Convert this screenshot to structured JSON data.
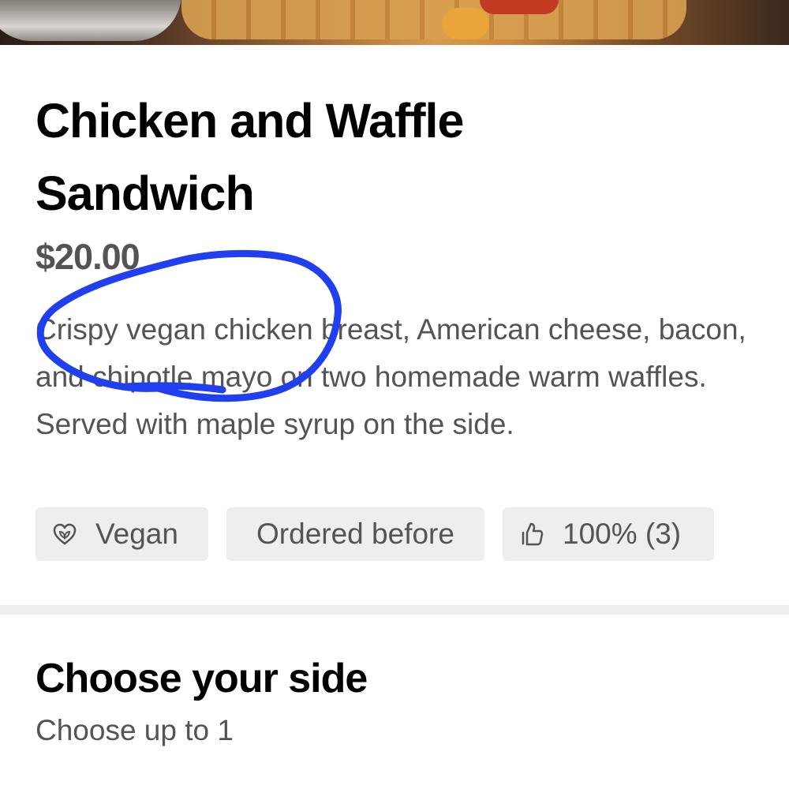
{
  "item": {
    "title": "Chicken and Waffle Sandwich",
    "price": "$20.00",
    "description": "Crispy vegan chicken breast, American cheese, bacon, and chipotle mayo on two homemade warm waffles. Served with maple syrup on the side."
  },
  "tags": {
    "vegan": "Vegan",
    "ordered_before": "Ordered before",
    "rating": "100% (3)"
  },
  "options_section": {
    "title": "Choose your side",
    "subtitle": "Choose up to 1"
  },
  "icons": {
    "vegan": "heart-leaf-icon",
    "rating": "thumbs-up-icon"
  },
  "colors": {
    "annotation": "#1f3ff0",
    "chip_background": "#eeeeee",
    "secondary_text": "#545454"
  }
}
